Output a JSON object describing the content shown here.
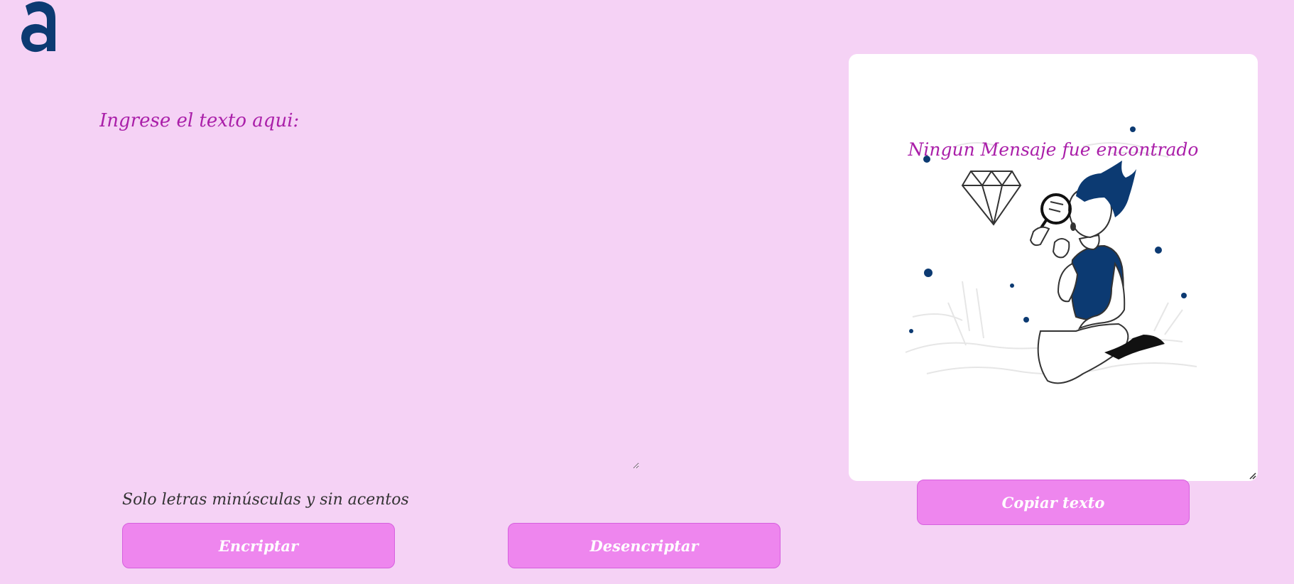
{
  "input": {
    "placeholder": "Ingrese el texto aqui:",
    "value": ""
  },
  "hint": {
    "text": "Solo letras minúsculas y sin acentos"
  },
  "buttons": {
    "encrypt_label": "Encriptar",
    "decrypt_label": "Desencriptar",
    "copy_label": "Copiar texto"
  },
  "output": {
    "message": "Ningun Mensaje fue encontrado"
  },
  "colors": {
    "page_background": "#f5d2f5",
    "accent_text": "#aa1fa9",
    "button_background": "#ee86ee",
    "button_text": "#ffffff",
    "logo": "#0c3a72"
  },
  "icons": {
    "logo": "alura-logo-icon",
    "illustration": "person-with-magnifier-icon"
  }
}
